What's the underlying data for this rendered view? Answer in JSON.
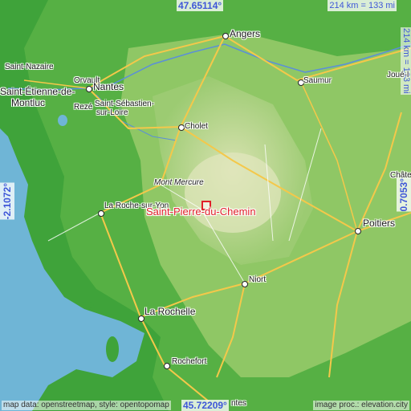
{
  "coordinates": {
    "top_lat": "47.65114°",
    "bottom_lat": "45.72209°",
    "left_lon": "-2.1072°",
    "right_lon": "0.7053°"
  },
  "scale": {
    "horizontal": "214 km = 133 mi",
    "vertical": "214 km = 133 mi"
  },
  "target": {
    "name": "Saint-Pierre-du-Chemin"
  },
  "cities": {
    "angers": "Angers",
    "orvault": "Orvault",
    "nantes": "Nantes",
    "saint_nazaire": "Saint-Nazaire",
    "saint_etienne": "Saint-Étienne-de-",
    "montluc": "Montluc",
    "reze": "Rezé",
    "saint_sebastien": "Saint-Sébastien-",
    "sur_loire": "sur-Loire",
    "cholet": "Cholet",
    "saumur": "Saumur",
    "joue": "Joué-l",
    "mont_mercure": "Mont Mercure",
    "la_roche": "La Roche-sur-Yon",
    "poitiers": "Poitiers",
    "chate": "Châte",
    "niort": "Niort",
    "la_rochelle": "La Rochelle",
    "rochefort": "Rochefort",
    "saintes": "ntes"
  },
  "attribution": {
    "left": "map data: openstreetmap, style: opentopomap",
    "right": "image proc.: elevation.city"
  },
  "colors": {
    "sea": "#6fb5d6",
    "lowland": "#3fa33a",
    "midland": "#8fc765",
    "upland": "#c9d9a0",
    "accent_label": "#e0202a",
    "coord_text": "#3f57d8"
  }
}
